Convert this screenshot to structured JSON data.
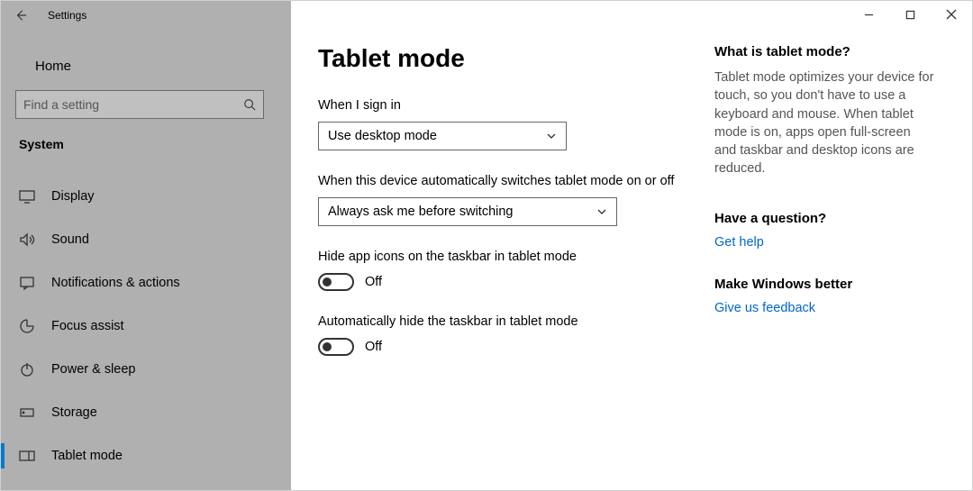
{
  "app": {
    "title": "Settings"
  },
  "sidebar": {
    "home": "Home",
    "search_placeholder": "Find a setting",
    "category": "System",
    "items": [
      {
        "label": "Display"
      },
      {
        "label": "Sound"
      },
      {
        "label": "Notifications & actions"
      },
      {
        "label": "Focus assist"
      },
      {
        "label": "Power & sleep"
      },
      {
        "label": "Storage"
      },
      {
        "label": "Tablet mode"
      }
    ]
  },
  "page": {
    "title": "Tablet mode",
    "signin_label": "When I sign in",
    "signin_value": "Use desktop mode",
    "switch_label": "When this device automatically switches tablet mode on or off",
    "switch_value": "Always ask me before switching",
    "hide_icons_label": "Hide app icons on the taskbar in tablet mode",
    "hide_icons_state": "Off",
    "hide_taskbar_label": "Automatically hide the taskbar in tablet mode",
    "hide_taskbar_state": "Off"
  },
  "aside": {
    "what_heading": "What is tablet mode?",
    "what_text": "Tablet mode optimizes your device for touch, so you don't have to use a keyboard and mouse. When tablet mode is on, apps open full-screen and taskbar and desktop icons are reduced.",
    "question_heading": "Have a question?",
    "help_link": "Get help",
    "better_heading": "Make Windows better",
    "feedback_link": "Give us feedback"
  }
}
